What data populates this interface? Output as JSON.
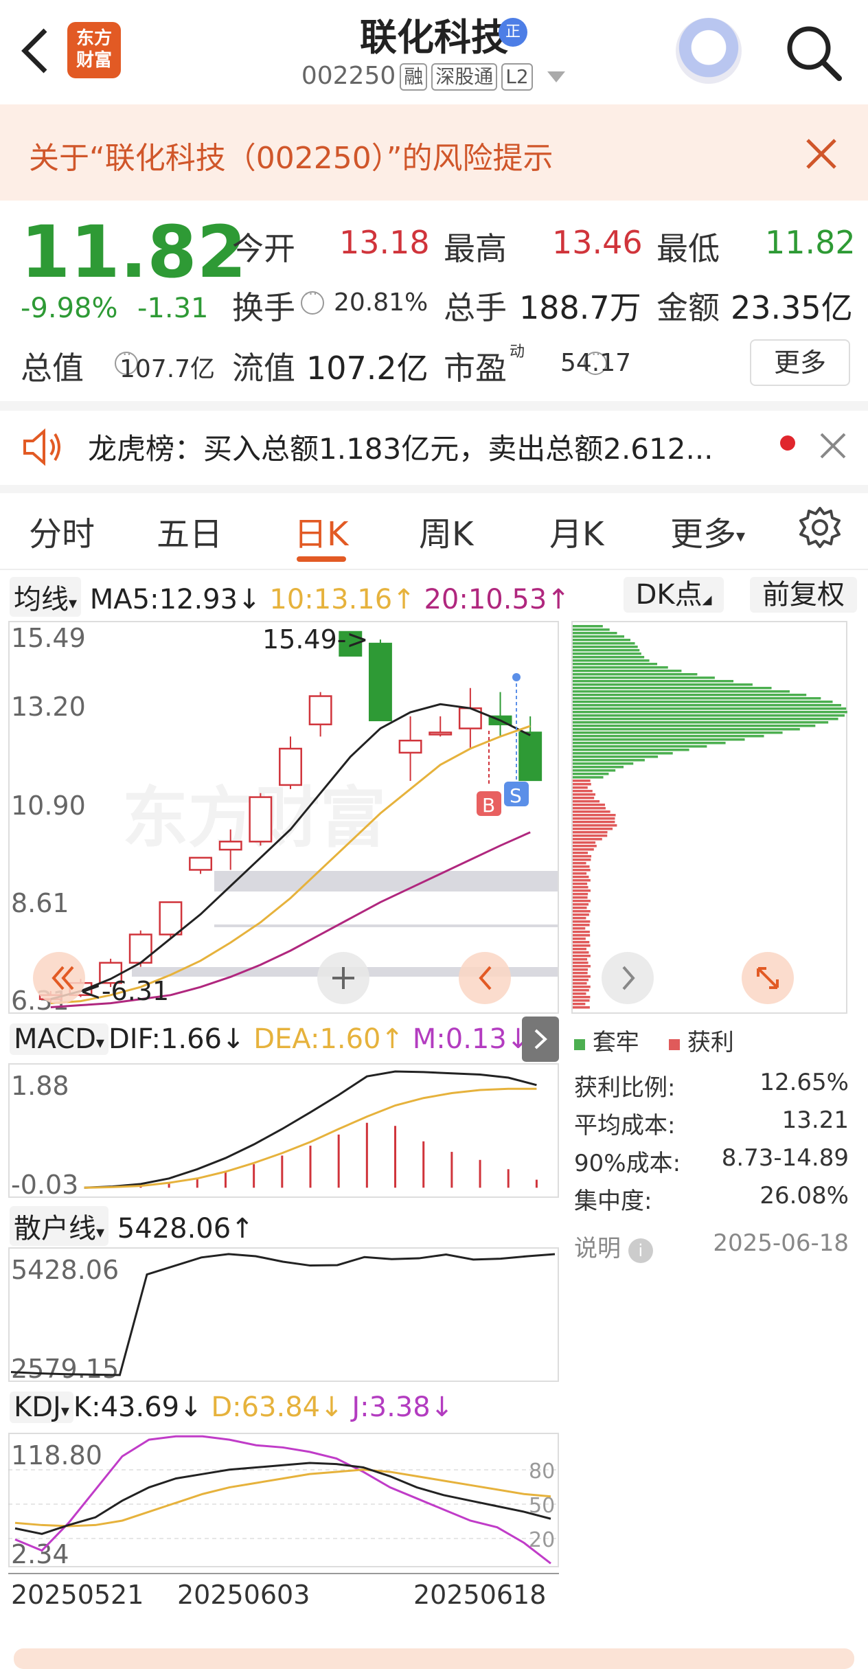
{
  "header": {
    "logo_line1": "东方",
    "logo_line2": "财富",
    "stock_name": "联化科技",
    "badge": "正",
    "stock_code": "002250",
    "tags": [
      "融",
      "深股通",
      "L2"
    ]
  },
  "risk_banner": {
    "text": "关于“联化科技（002250）”的风险提示"
  },
  "quote": {
    "price": "11.82",
    "change_pct": "-9.98%",
    "change": "-1.31",
    "open_label": "今开",
    "open": "13.18",
    "high_label": "最高",
    "high": "13.46",
    "low_label": "最低",
    "low": "11.82",
    "turnover_label": "换手",
    "turnover": "20.81%",
    "volume_label": "总手",
    "volume": "188.7万",
    "amount_label": "金额",
    "amount": "23.35亿",
    "mktcap_label": "总值",
    "mktcap": "107.7亿",
    "float_label": "流值",
    "float": "107.2亿",
    "pe_label": "市盈",
    "pe_sup": "动",
    "pe": "54.17",
    "more": "更多"
  },
  "dragon_tiger": {
    "text": "龙虎榜：买入总额1.183亿元，卖出总额2.612..."
  },
  "tabs": [
    "分时",
    "五日",
    "日K",
    "周K",
    "月K",
    "更多"
  ],
  "active_tab": "日K",
  "ma_bar": {
    "selector": "均线",
    "ma5": "MA5:12.93↓",
    "ma10": "10:13.16↑",
    "ma20": "20:10.53↑",
    "dk": "DK点",
    "adjust": "前复权"
  },
  "main_chart": {
    "yticks": [
      "15.49",
      "13.20",
      "10.90",
      "8.61",
      "6.31"
    ],
    "high_label": "15.49->",
    "low_label": "<-6.31",
    "watermark": "东方财富",
    "marker_b": "B",
    "marker_s": "S"
  },
  "macd_bar": {
    "selector": "MACD",
    "dif": "DIF:1.66↓",
    "dea": "DEA:1.60↑",
    "m": "M:0.13↓",
    "yticks": [
      "1.88",
      "-0.03"
    ]
  },
  "retail_bar": {
    "selector": "散户线",
    "value": "5428.06↑",
    "yticks": [
      "5428.06",
      "2579.15"
    ]
  },
  "kdj_bar": {
    "selector": "KDJ",
    "k": "K:43.69↓",
    "d": "D:63.84↓",
    "j": "J:3.38↓",
    "yticks": [
      "118.80",
      "2.34"
    ],
    "levels": [
      "80",
      "50",
      "20"
    ]
  },
  "x_axis": [
    "20250521",
    "20250603",
    "20250618"
  ],
  "chip": {
    "legend_trapped": "套牢",
    "legend_profit": "获利",
    "stats": [
      {
        "label": "获利比例:",
        "value": "12.65%"
      },
      {
        "label": "平均成本:",
        "value": "13.21"
      },
      {
        "label": "90%成本:",
        "value": "8.73-14.89"
      },
      {
        "label": "集中度:",
        "value": "26.08%"
      }
    ],
    "note": "说明",
    "date": "2025-06-18"
  },
  "colors": {
    "up": "#d0343b",
    "down": "#2e9a35",
    "accent": "#e25a24",
    "ma10": "#e6b23c",
    "ma20": "#b0277e"
  },
  "chart_data": [
    {
      "type": "candlestick",
      "title": "",
      "ylim": [
        6.31,
        15.49
      ],
      "candles": [
        {
          "o": 6.4,
          "h": 6.6,
          "l": 6.31,
          "c": 6.5
        },
        {
          "o": 6.5,
          "h": 6.9,
          "l": 6.45,
          "c": 6.8
        },
        {
          "o": 6.8,
          "h": 7.4,
          "l": 6.7,
          "c": 7.3
        },
        {
          "o": 7.3,
          "h": 8.1,
          "l": 7.2,
          "c": 8.0
        },
        {
          "o": 8.0,
          "h": 8.8,
          "l": 7.9,
          "c": 8.8
        },
        {
          "o": 9.6,
          "h": 9.9,
          "l": 9.5,
          "c": 9.9
        },
        {
          "o": 10.1,
          "h": 10.6,
          "l": 9.6,
          "c": 10.3
        },
        {
          "o": 10.3,
          "h": 11.5,
          "l": 10.2,
          "c": 11.4
        },
        {
          "o": 11.7,
          "h": 12.9,
          "l": 11.6,
          "c": 12.6
        },
        {
          "o": 13.2,
          "h": 14.0,
          "l": 12.9,
          "c": 13.9
        },
        {
          "o": 15.49,
          "h": 15.49,
          "l": 14.9,
          "c": 14.9
        },
        {
          "o": 15.2,
          "h": 15.3,
          "l": 13.3,
          "c": 13.3
        },
        {
          "o": 12.5,
          "h": 13.4,
          "l": 11.8,
          "c": 12.8
        },
        {
          "o": 13.0,
          "h": 13.4,
          "l": 12.9,
          "c": 13.0
        },
        {
          "o": 13.1,
          "h": 14.1,
          "l": 12.6,
          "c": 13.6
        },
        {
          "o": 13.4,
          "h": 14.0,
          "l": 12.9,
          "c": 13.2
        },
        {
          "o": 13.0,
          "h": 13.4,
          "l": 11.82,
          "c": 11.82
        }
      ],
      "ma5": [
        6.4,
        6.6,
        6.9,
        7.3,
        7.9,
        8.5,
        9.2,
        9.9,
        10.6,
        11.5,
        12.4,
        13.1,
        13.5,
        13.7,
        13.6,
        13.3,
        12.93
      ],
      "ma10": [
        6.3,
        6.35,
        6.5,
        6.7,
        7.0,
        7.35,
        7.8,
        8.3,
        8.9,
        9.6,
        10.3,
        11.0,
        11.6,
        12.2,
        12.6,
        12.9,
        13.16
      ],
      "ma20": [
        6.2,
        6.25,
        6.3,
        6.4,
        6.5,
        6.7,
        6.95,
        7.25,
        7.6,
        8.0,
        8.4,
        8.8,
        9.15,
        9.5,
        9.85,
        10.2,
        10.53
      ]
    },
    {
      "type": "bar",
      "title": "MACD",
      "ylim": [
        -0.03,
        1.88
      ],
      "m": [
        0.0,
        0.01,
        0.03,
        0.07,
        0.14,
        0.25,
        0.38,
        0.52,
        0.68,
        0.86,
        1.05,
        1.0,
        0.75,
        0.58,
        0.45,
        0.3,
        0.13
      ],
      "dif": [
        0.0,
        0.02,
        0.06,
        0.15,
        0.3,
        0.48,
        0.7,
        0.95,
        1.22,
        1.5,
        1.8,
        1.88,
        1.87,
        1.85,
        1.83,
        1.78,
        1.66
      ],
      "dea": [
        0.0,
        0.01,
        0.03,
        0.08,
        0.15,
        0.26,
        0.4,
        0.56,
        0.74,
        0.95,
        1.15,
        1.33,
        1.45,
        1.53,
        1.58,
        1.6,
        1.6
      ]
    },
    {
      "type": "line",
      "title": "散户线",
      "ylim": [
        2579.15,
        5428.06
      ],
      "values": [
        2650,
        2620,
        2600,
        2590,
        2580,
        4950,
        5150,
        5350,
        5430,
        5380,
        5250,
        5160,
        5170,
        5360,
        5310,
        5330,
        5420,
        5300,
        5320,
        5380,
        5428.06
      ]
    },
    {
      "type": "line",
      "title": "KDJ",
      "ylim": [
        2.34,
        118.8
      ],
      "k": [
        35,
        30,
        38,
        45,
        60,
        72,
        80,
        84,
        88,
        90,
        92,
        94,
        93,
        90,
        82,
        72,
        65,
        60,
        55,
        50,
        43.69
      ],
      "d": [
        40,
        38,
        37,
        38,
        42,
        50,
        58,
        66,
        72,
        76,
        80,
        84,
        86,
        88,
        86,
        82,
        78,
        74,
        70,
        66,
        63.84
      ],
      "j": [
        25,
        15,
        40,
        70,
        100,
        115,
        118,
        118,
        115,
        110,
        108,
        104,
        98,
        86,
        72,
        62,
        52,
        42,
        36,
        22,
        3.38
      ]
    }
  ]
}
